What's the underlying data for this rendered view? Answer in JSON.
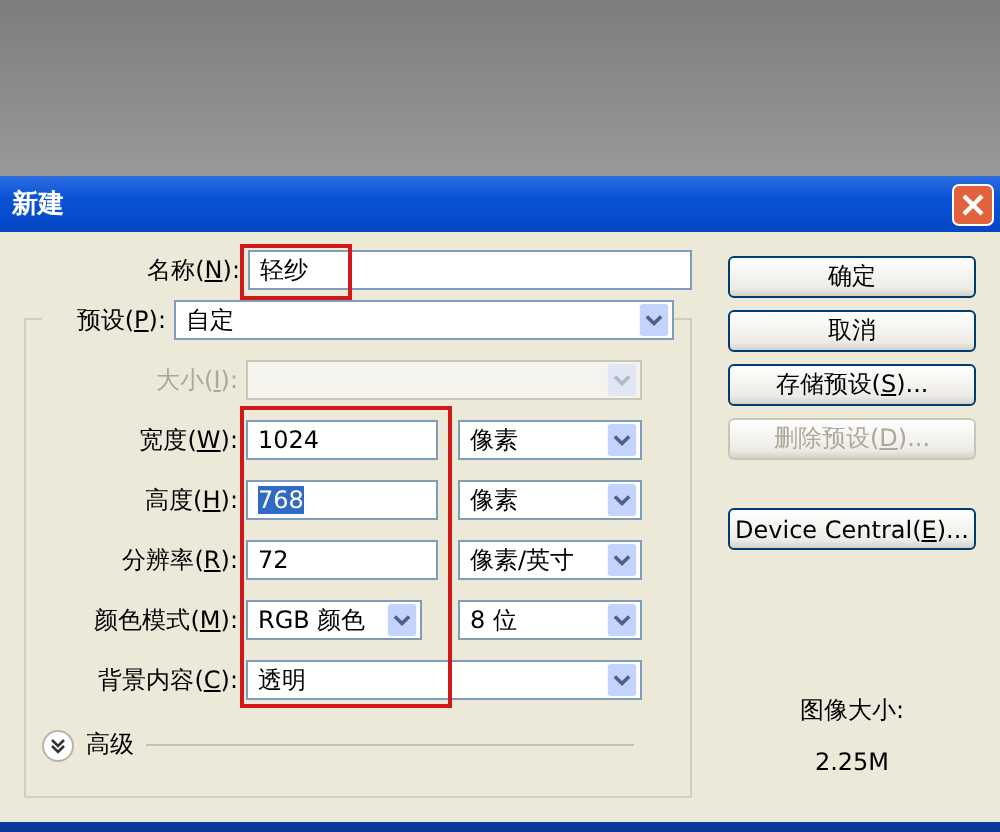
{
  "window": {
    "title": "新建"
  },
  "name_field": {
    "label": {
      "pre": "名称(",
      "key": "N",
      "post": "):"
    },
    "value": "轻纱"
  },
  "preset": {
    "label": {
      "pre": "预设(",
      "key": "P",
      "post": "):"
    },
    "value": "自定"
  },
  "size": {
    "label": {
      "pre": "大小(",
      "key": "I",
      "post": "):"
    },
    "disabled": true
  },
  "rows": [
    {
      "kind": "input",
      "label": {
        "pre": "宽度(",
        "key": "W",
        "post": "):"
      },
      "value": "1024",
      "text_selected": false,
      "unit": "像素"
    },
    {
      "kind": "input",
      "label": {
        "pre": "高度(",
        "key": "H",
        "post": "):"
      },
      "value": "768",
      "text_selected": true,
      "unit": "像素"
    },
    {
      "kind": "input",
      "label": {
        "pre": "分辨率(",
        "key": "R",
        "post": "):"
      },
      "value": "72",
      "text_selected": false,
      "unit": "像素/英寸"
    },
    {
      "kind": "select",
      "label": {
        "pre": "颜色模式(",
        "key": "M",
        "post": "):"
      },
      "value": "RGB 颜色",
      "unit": "8 位"
    },
    {
      "kind": "wide",
      "label": {
        "pre": "背景内容(",
        "key": "C",
        "post": "):"
      },
      "value": "透明"
    }
  ],
  "advanced": {
    "label": "高级",
    "expanded": false
  },
  "buttons": [
    {
      "pre": "确定",
      "disabled": false
    },
    {
      "pre": "取消",
      "disabled": false
    },
    {
      "pre": "存储预设(",
      "key": "S",
      "post": ")...",
      "disabled": false
    },
    {
      "pre": "删除预设(",
      "key": "D",
      "post": ")...",
      "disabled": true
    }
  ],
  "device_central": {
    "pre": "Device Central(",
    "key": "E",
    "post": ")...",
    "disabled": false
  },
  "image_size": {
    "label": "图像大小:",
    "value": "2.25M"
  }
}
